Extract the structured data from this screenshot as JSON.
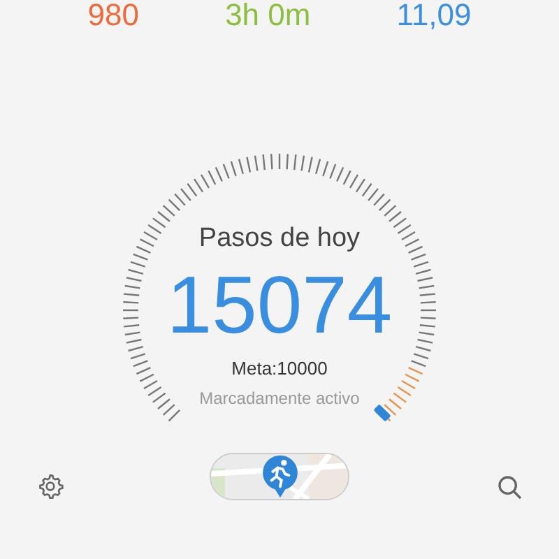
{
  "stats": [
    {
      "value": "980",
      "color": "#ee6a3a"
    },
    {
      "value": "3h 0m",
      "color": "#8cbf3f"
    },
    {
      "value": "11,09",
      "color": "#3b8fe0"
    }
  ],
  "gauge": {
    "title": "Pasos de hoy",
    "steps": "15074",
    "goal": "Meta:10000",
    "status": "Marcadamente activo"
  }
}
